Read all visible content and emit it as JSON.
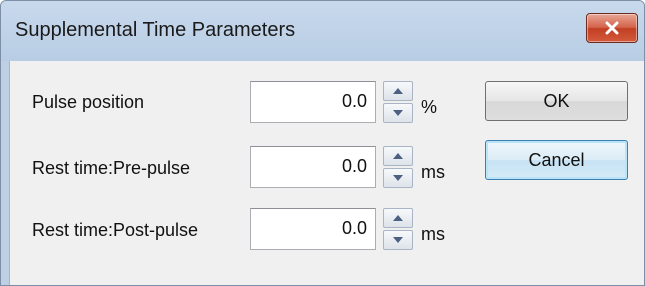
{
  "window": {
    "title": "Supplemental Time Parameters",
    "close_icon": "close-icon"
  },
  "fields": [
    {
      "label": "Pulse position",
      "value": "0.0",
      "unit": "%"
    },
    {
      "label": "Rest time:Pre-pulse",
      "value": "0.0",
      "unit": "ms"
    },
    {
      "label": "Rest time:Post-pulse",
      "value": "0.0",
      "unit": "ms"
    }
  ],
  "buttons": {
    "ok_label": "OK",
    "cancel_label": "Cancel"
  },
  "colors": {
    "titlebar": "#bdd0e4",
    "client": "#f0f0f0",
    "close_button": "#c94a30",
    "default_button_border": "#3c7fb1"
  }
}
